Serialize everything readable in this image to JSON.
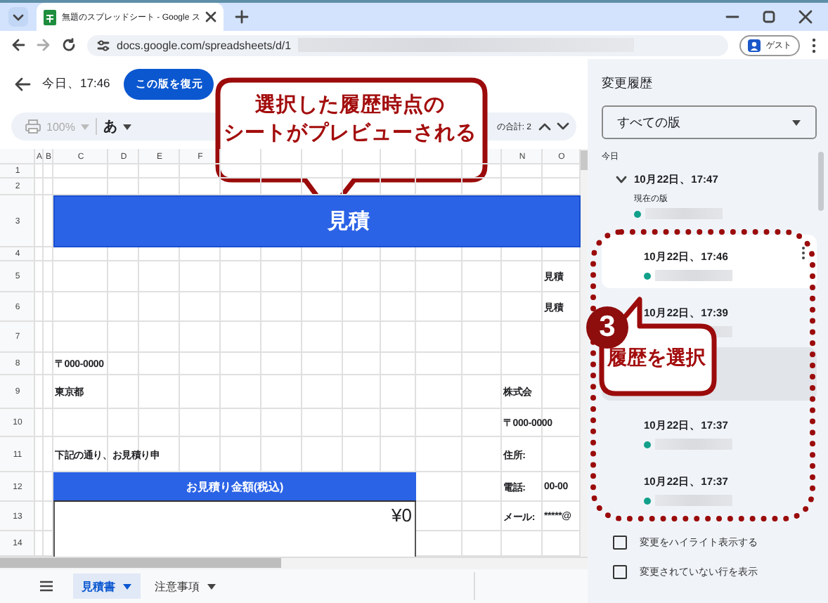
{
  "browser": {
    "tab_title": "無題のスプレッドシート - Google ス",
    "url": "docs.google.com/spreadsheets/d/1",
    "profile": "ゲスト"
  },
  "header": {
    "title": "今日、17:46",
    "restore_button": "この版を復元"
  },
  "toolbar": {
    "zoom": "100%",
    "input_mode": "あ",
    "sum": "の合計: 2"
  },
  "sheet": {
    "columns": [
      "A",
      "B",
      "C",
      "D",
      "E",
      "F",
      "N",
      "O"
    ],
    "rows": [
      "1",
      "2",
      "3",
      "4",
      "5",
      "6",
      "7",
      "8",
      "9",
      "10",
      "11",
      "12",
      "13",
      "14"
    ],
    "cells": [
      {
        "text": "見積",
        "kind": "banner"
      },
      {
        "text": "見積",
        "kind": "label"
      },
      {
        "text": "見積",
        "kind": "label"
      },
      {
        "text": "〒000-0000",
        "kind": "text"
      },
      {
        "text": "東京都",
        "kind": "label"
      },
      {
        "text": "株式会",
        "kind": "label"
      },
      {
        "text": "〒000-0000",
        "kind": "text"
      },
      {
        "text": "下記の通り、お見積り申",
        "kind": "label"
      },
      {
        "text": "住所:",
        "kind": "label"
      },
      {
        "text": "お見積り金額(税込)",
        "kind": "heading"
      },
      {
        "text": "電話:",
        "kind": "label"
      },
      {
        "text": "00-00",
        "kind": "text"
      },
      {
        "text": "¥0",
        "kind": "amount"
      },
      {
        "text": "メール:",
        "kind": "label"
      },
      {
        "text": "*****@",
        "kind": "text"
      }
    ],
    "tabs": [
      {
        "label": "見積書",
        "selected": true
      },
      {
        "label": "注意事項",
        "selected": false
      }
    ]
  },
  "history": {
    "title": "変更履歴",
    "filter": "すべての版",
    "section": "今日",
    "versions": [
      {
        "date": "10月22日、17:47",
        "note": "現在の版",
        "selected": false,
        "expanded": true,
        "children": [
          {
            "date": "10月22日、17:46",
            "selected": true,
            "hovered": false
          },
          {
            "date": "10月22日、17:39",
            "selected": false,
            "hovered": false
          },
          {
            "selected": false,
            "hovered": true
          },
          {
            "date": "10月22日、17:37",
            "selected": false,
            "hovered": false
          },
          {
            "date": "10月22日、17:37",
            "selected": false,
            "hovered": false
          }
        ]
      }
    ],
    "options": [
      {
        "label": "変更をハイライト表示する",
        "checked": false
      },
      {
        "label": "変更されていない行を表示",
        "checked": false
      }
    ]
  },
  "annotations": [
    {
      "kind": "callout",
      "lines": [
        "選択した履歴時点の",
        "シートがプレビューされる"
      ]
    },
    {
      "kind": "step",
      "number": "3",
      "text": "履歴を選択"
    }
  ]
}
